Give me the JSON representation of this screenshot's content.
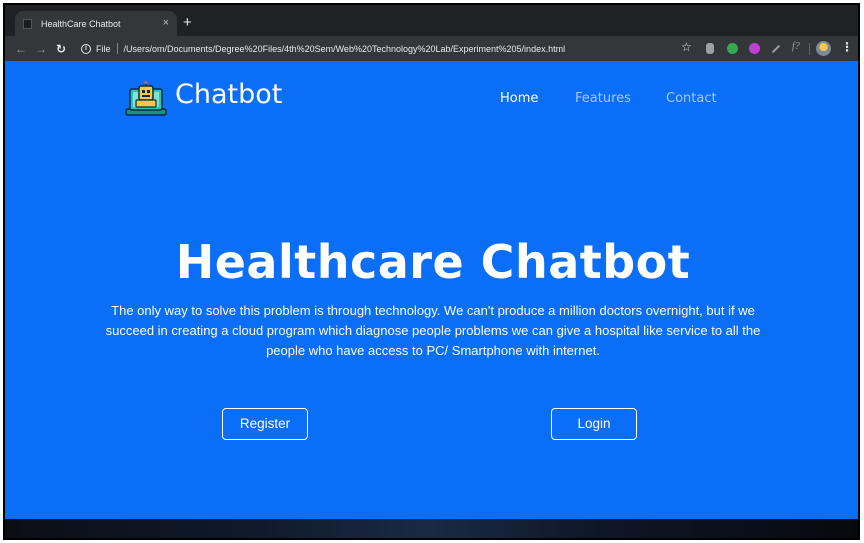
{
  "browser": {
    "tab_title": "HealthCare Chatbot",
    "tab_close": "×",
    "new_tab": "+",
    "scheme_label": "File",
    "url": "/Users/om/Documents/Degree%20Files/4th%20Sem/Web%20Technology%20Lab/Experiment%205/index.html",
    "icons": [
      "back-icon",
      "forward-icon",
      "reload-icon",
      "info-icon",
      "star-icon",
      "extension-icons",
      "profile-avatar",
      "menu-icon"
    ]
  },
  "site": {
    "brand": "Chatbot",
    "nav": {
      "home": "Home",
      "features": "Features",
      "contact": "Contact"
    },
    "hero": {
      "title": "Healthcare Chatbot",
      "description": "The only way to solve this problem is through technology. We can't produce a million doctors overnight, but if we succeed in creating a cloud program which diagnose people problems we can give a hospital like service to all the people who have access to PC/ Smartphone with internet."
    },
    "buttons": {
      "register": "Register",
      "login": "Login"
    }
  },
  "colors": {
    "page_background": "#0a6ef7",
    "nav_active": "#ffffff",
    "nav_inactive": "#a9c8f5",
    "browser_chrome": "#35363a"
  }
}
